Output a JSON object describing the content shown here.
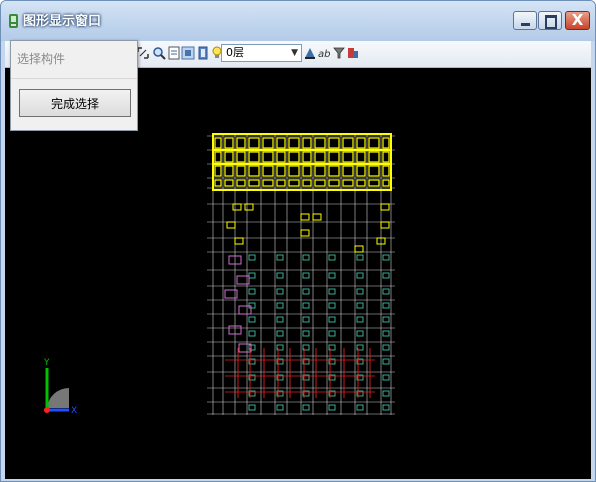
{
  "window": {
    "title": "图形显示窗口",
    "buttons": {
      "minimize_icon": "minimize-icon",
      "maximize_icon": "maximize-icon",
      "close_glyph": "X"
    }
  },
  "toolbar": {
    "icons": [
      "zoom-window-icon",
      "zoom-icon",
      "page-icon",
      "layer-icon",
      "book-icon",
      "light-bulb-icon"
    ],
    "layer_select": {
      "value": "0层"
    },
    "trailing_icons": [
      "layer-manager-icon",
      "text-style-icon",
      "filter-icon",
      "color-icon"
    ]
  },
  "popup": {
    "title": "选择构件",
    "finish_button": "完成选择"
  },
  "axis": {
    "y_label": "Y",
    "x_label": "X"
  },
  "colors": {
    "canvas_background": "#000000",
    "structure_yellow": "#ffff00",
    "grid_lines": "#d0d0d0",
    "component_green": "#3fbf9f",
    "rebar_red": "#e02020",
    "component_magenta": "#d070d0"
  }
}
